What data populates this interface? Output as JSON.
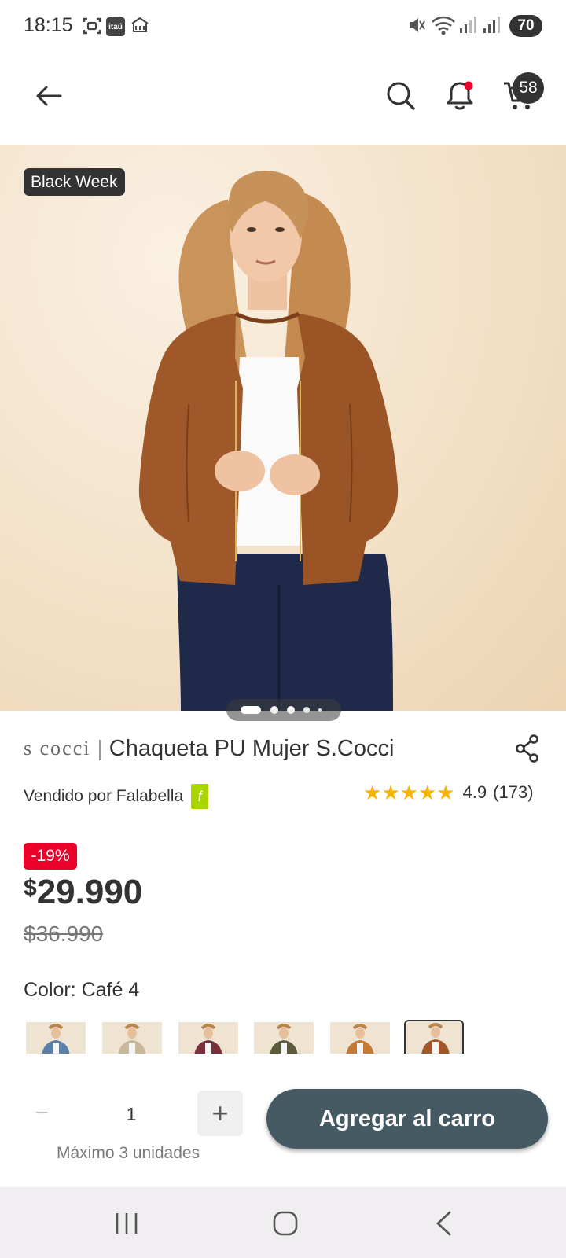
{
  "status_bar": {
    "time": "18:15",
    "bank_app_label": "itaú",
    "battery": "70"
  },
  "nav": {
    "back_icon": "arrow-left-icon",
    "search_icon": "search-icon",
    "bell_icon": "bell-icon",
    "cart_icon": "cart-icon",
    "cart_count": "58"
  },
  "product": {
    "badge": "Black Week",
    "image_count": 5,
    "active_image_index": 0,
    "brand": "s cocci",
    "separator": "|",
    "title": "Chaqueta PU Mujer S.Cocci",
    "sold_by": "Vendido por Falabella",
    "seller_badge": "f",
    "rating_value": "4.9",
    "rating_count": "(173)",
    "stars": 5,
    "discount": "-19%",
    "price_currency": "$",
    "price": "29.990",
    "old_price": "$36.990",
    "color_label": "Color:",
    "color_value": "Café 4",
    "swatches": [
      {
        "name": "Azul",
        "color": "#5b7fa8"
      },
      {
        "name": "Beige",
        "color": "#c9b89a"
      },
      {
        "name": "Burdeo",
        "color": "#7a2f3c"
      },
      {
        "name": "Verde",
        "color": "#5c5a3a"
      },
      {
        "name": "Camel",
        "color": "#c27a35"
      },
      {
        "name": "Café 4",
        "color": "#a0582a"
      }
    ],
    "selected_swatch": 5
  },
  "cart_bar": {
    "minus": "−",
    "quantity": "1",
    "plus": "+",
    "max_text": "Máximo 3 unidades",
    "add_to_cart": "Agregar al carro"
  },
  "colors": {
    "accent_dark": "#333333",
    "discount_red": "#eb0029",
    "button_bg": "#465a64",
    "star": "#f7b500",
    "falabella_green": "#aad500"
  }
}
